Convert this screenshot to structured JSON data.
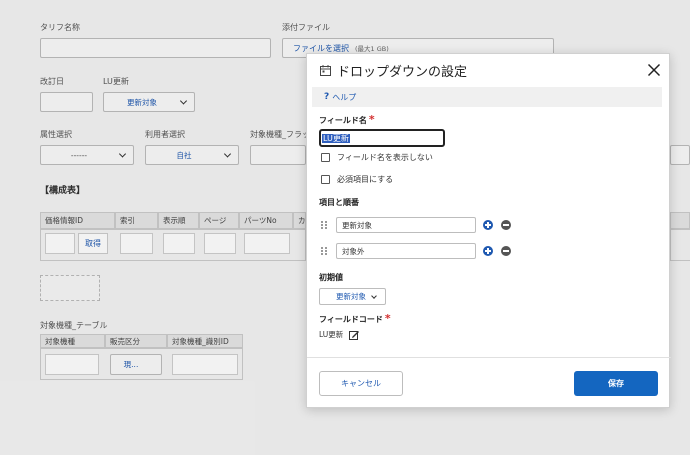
{
  "background": {
    "tariff_name_label": "タリフ名称",
    "attachment_label": "添付ファイル",
    "file_select_label": "ファイルを選択",
    "file_limit": "(最大1 GB)",
    "revision_date_label": "改訂日",
    "lu_update_label": "LU更新",
    "lu_update_value": "更新対象",
    "attribute_select_label": "属性選択",
    "attribute_select_value": "------",
    "user_select_label": "利用者選択",
    "user_select_value": "自社",
    "target_flag_label": "対象機種_フラッ",
    "composition_heading": "【構成表】",
    "table1": {
      "columns": [
        "価格情報ID",
        "索引",
        "表示順",
        "ページ",
        "パーツNo",
        "カ"
      ],
      "fetch_label": "取得"
    },
    "table2_label": "対象機種_テーブル",
    "table2": {
      "columns": [
        "対象機種",
        "販売区分",
        "対象機種_識別ID"
      ],
      "sales_value": "現..."
    }
  },
  "modal": {
    "title": "ドロップダウンの設定",
    "help_label": "ヘルプ",
    "field_name_label": "フィールド名",
    "field_name_value": "LU更新",
    "hide_label_text": "フィールド名を表示しない",
    "required_text": "必須項目にする",
    "items_label": "項目と順番",
    "items": [
      "更新対象",
      "対象外"
    ],
    "default_label": "初期値",
    "default_value": "更新対象",
    "field_code_label": "フィールドコード",
    "field_code_value": "LU更新",
    "cancel_label": "キャンセル",
    "save_label": "保存"
  },
  "colors": {
    "accent": "#1e58b0",
    "primary_button": "#1466c0",
    "required": "#d32f2f",
    "selection": "#2f5fbf"
  }
}
